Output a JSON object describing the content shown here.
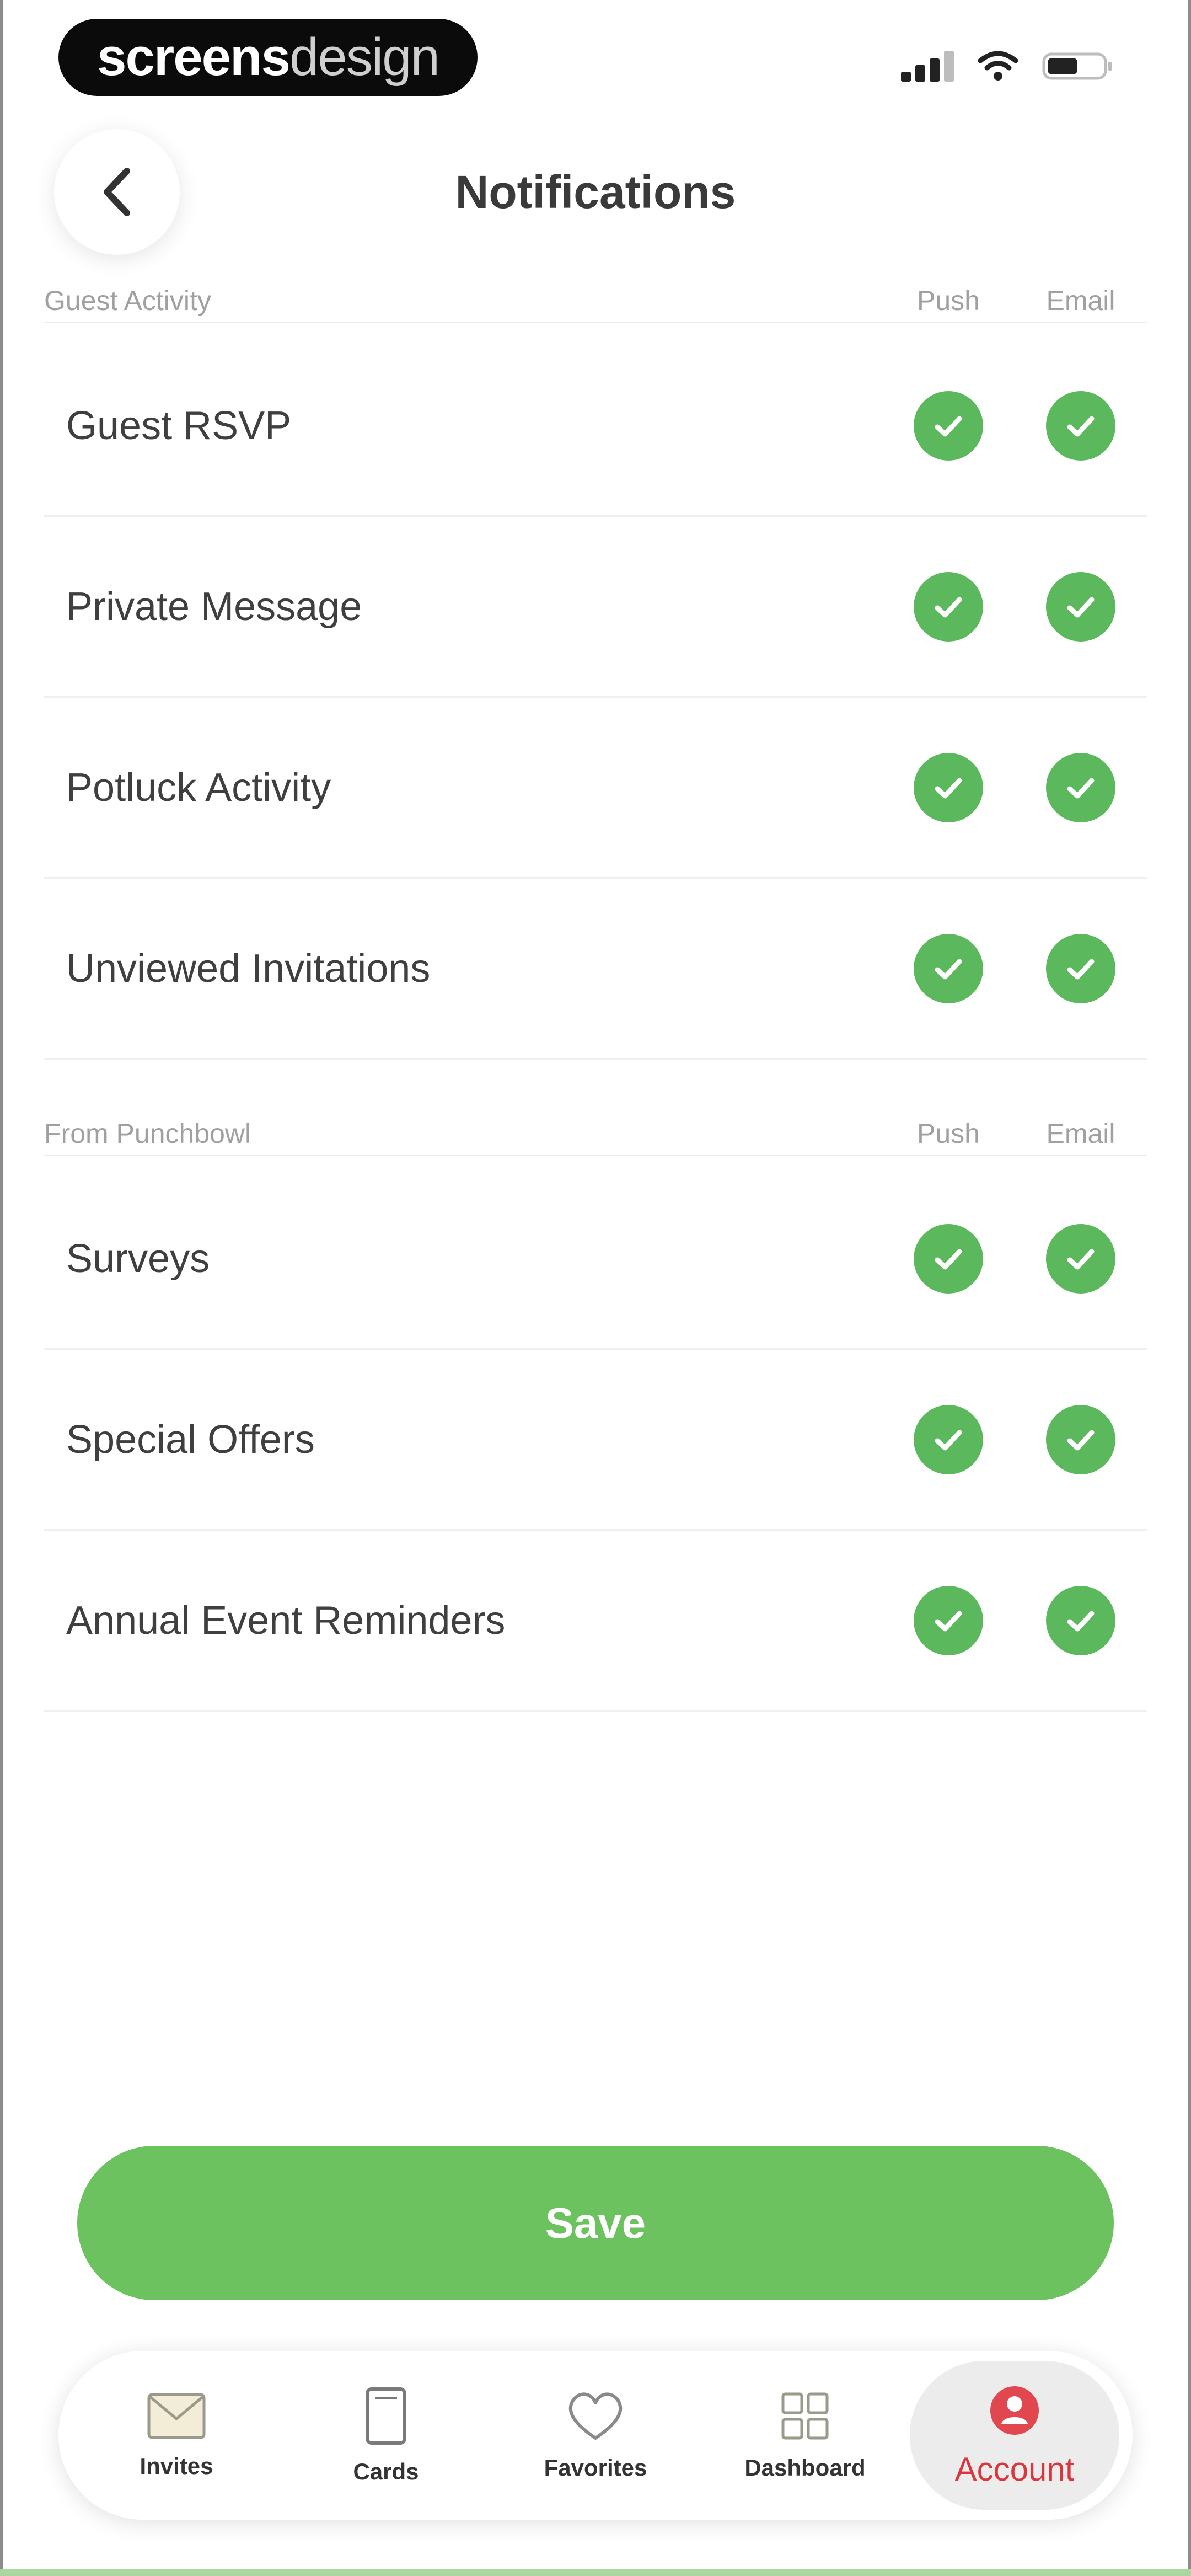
{
  "status_bar": {
    "brand_strong": "screens",
    "brand_light": "design",
    "icons": [
      "signal-icon",
      "wifi-icon",
      "battery-icon"
    ]
  },
  "header": {
    "title": "Notifications",
    "back_icon": "chevron-left-icon"
  },
  "sections": [
    {
      "label": "Guest Activity",
      "col_push": "Push",
      "col_email": "Email",
      "items": [
        {
          "label": "Guest RSVP",
          "push": true,
          "email": true
        },
        {
          "label": "Private Message",
          "push": true,
          "email": true
        },
        {
          "label": "Potluck Activity",
          "push": true,
          "email": true
        },
        {
          "label": "Unviewed Invitations",
          "push": true,
          "email": true
        }
      ]
    },
    {
      "label": "From Punchbowl",
      "col_push": "Push",
      "col_email": "Email",
      "items": [
        {
          "label": "Surveys",
          "push": true,
          "email": true
        },
        {
          "label": "Special Offers",
          "push": true,
          "email": true
        },
        {
          "label": "Annual Event Reminders",
          "push": true,
          "email": true
        }
      ]
    }
  ],
  "save_label": "Save",
  "tabbar": {
    "tabs": [
      {
        "label": "Invites",
        "icon": "envelope-icon",
        "active": false
      },
      {
        "label": "Cards",
        "icon": "card-icon",
        "active": false
      },
      {
        "label": "Favorites",
        "icon": "heart-icon",
        "active": false
      },
      {
        "label": "Dashboard",
        "icon": "grid-icon",
        "active": false
      },
      {
        "label": "Account",
        "icon": "account-icon",
        "active": true
      }
    ]
  },
  "colors": {
    "check_green": "#5cb85c",
    "save_green": "#6cc25e",
    "active_red": "#d9363e"
  }
}
